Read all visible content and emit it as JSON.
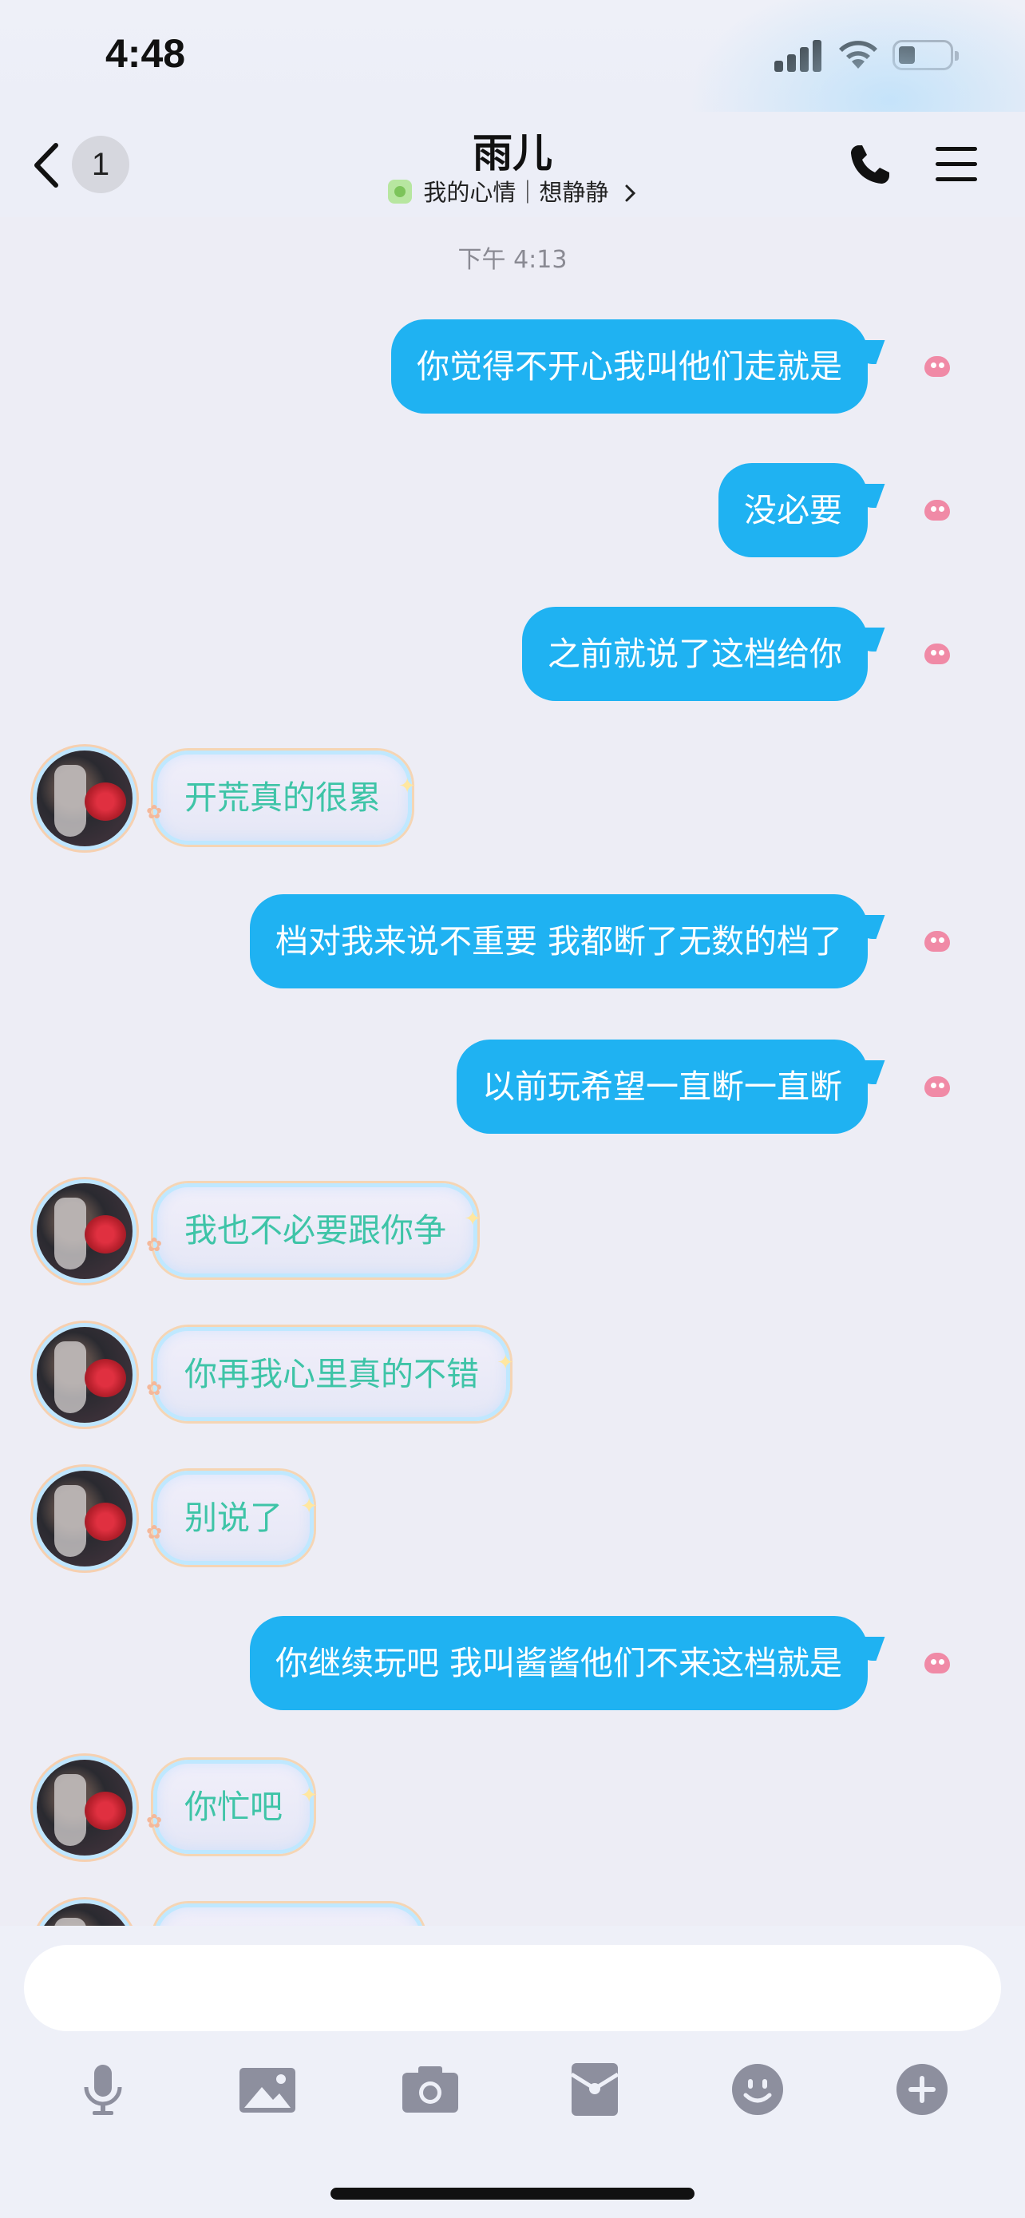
{
  "status_bar": {
    "time": "4:48"
  },
  "nav": {
    "unread_count": "1",
    "contact_name": "雨儿",
    "mood_text": "我的心情｜想静静"
  },
  "chat": {
    "timestamp": "下午 4:13",
    "messages": [
      {
        "direction": "out",
        "text": "你觉得不开心我叫他们走就是"
      },
      {
        "direction": "out",
        "text": "没必要"
      },
      {
        "direction": "out",
        "text": "之前就说了这档给你"
      },
      {
        "direction": "in",
        "text": "开荒真的很累"
      },
      {
        "direction": "out",
        "text": "档对我来说不重要 我都断了无数的档了"
      },
      {
        "direction": "out",
        "text": "以前玩希望一直断一直断"
      },
      {
        "direction": "in",
        "text": "我也不必要跟你争"
      },
      {
        "direction": "in",
        "text": "你再我心里真的不错"
      },
      {
        "direction": "in",
        "text": "别说了"
      },
      {
        "direction": "out",
        "text": "你继续玩吧 我叫酱酱他们不来这档就是"
      },
      {
        "direction": "in",
        "text": "你忙吧"
      },
      {
        "direction": "in",
        "text": ""
      }
    ]
  },
  "input": {
    "value": "",
    "placeholder": ""
  },
  "toolbar": {
    "items": [
      "microphone-icon",
      "image-icon",
      "camera-icon",
      "red-packet-icon",
      "emoji-icon",
      "plus-icon"
    ]
  },
  "colors": {
    "outgoing_bubble": "#1fb2f2",
    "incoming_text": "#3ec4a7",
    "background": "#ededf5"
  }
}
